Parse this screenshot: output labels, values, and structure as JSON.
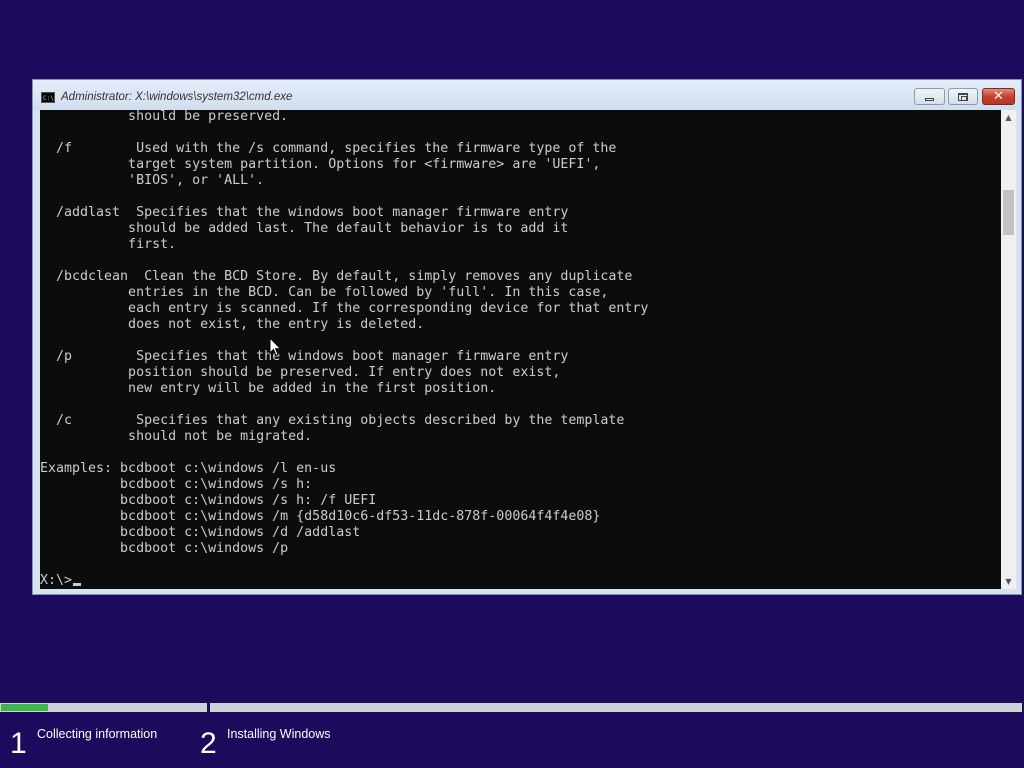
{
  "window": {
    "title": "Administrator: X:\\windows\\system32\\cmd.exe",
    "icon": "cmd-icon",
    "icon_text": "C:\\",
    "buttons": {
      "minimize": "minimize-icon",
      "maximize": "maximize-icon",
      "close": "✕"
    }
  },
  "console": {
    "lines": [
      "           should be preserved.",
      "",
      "  /f        Used with the /s command, specifies the firmware type of the",
      "           target system partition. Options for <firmware> are 'UEFI',",
      "           'BIOS', or 'ALL'.",
      "",
      "  /addlast  Specifies that the windows boot manager firmware entry",
      "           should be added last. The default behavior is to add it",
      "           first.",
      "",
      "  /bcdclean  Clean the BCD Store. By default, simply removes any duplicate",
      "           entries in the BCD. Can be followed by 'full'. In this case,",
      "           each entry is scanned. If the corresponding device for that entry",
      "           does not exist, the entry is deleted.",
      "",
      "  /p        Specifies that the windows boot manager firmware entry",
      "           position should be preserved. If entry does not exist,",
      "           new entry will be added in the first position.",
      "",
      "  /c        Specifies that any existing objects described by the template",
      "           should not be migrated.",
      "",
      "Examples: bcdboot c:\\windows /l en-us",
      "          bcdboot c:\\windows /s h:",
      "          bcdboot c:\\windows /s h: /f UEFI",
      "          bcdboot c:\\windows /m {d58d10c6-df53-11dc-878f-00064f4f4e08}",
      "          bcdboot c:\\windows /d /addlast",
      "          bcdboot c:\\windows /p",
      ""
    ],
    "prompt": "X:\\>",
    "text_color": "#cccccc",
    "background_color": "#0c0c0c"
  },
  "scrollbar": {
    "up_icon": "▲",
    "down_icon": "▼"
  },
  "setup": {
    "progress": 0.23,
    "progress_color": "#3db54a",
    "background_color": "#1e0a5c",
    "steps": [
      {
        "number": "1",
        "label": "Collecting information"
      },
      {
        "number": "2",
        "label": "Installing Windows"
      }
    ]
  }
}
